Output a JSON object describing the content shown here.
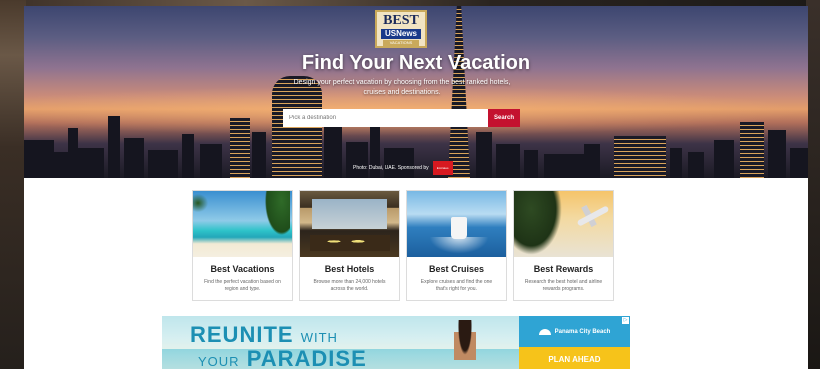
{
  "header": {
    "logo": {
      "best": "BEST",
      "brand": "USNews",
      "sub": "VACATIONS"
    },
    "title": "Find Your Next Vacation",
    "subtitle": "Design your perfect vacation by choosing from the best ranked hotels, cruises and destinations.",
    "search": {
      "placeholder": "Pick a destination",
      "button_label": "Search"
    },
    "photo_credit": "Photo: Dubai, UAE. Sponsored by",
    "sponsor": "Emirates"
  },
  "cards": [
    {
      "title": "Best Vacations",
      "description": "Find the perfect vacation based on region and type."
    },
    {
      "title": "Best Hotels",
      "description": "Browse more than 24,000 hotels across the world."
    },
    {
      "title": "Best Cruises",
      "description": "Explore cruises and find the one that's right for you."
    },
    {
      "title": "Best Rewards",
      "description": "Research the best hotel and airline rewards programs."
    }
  ],
  "ad": {
    "line1_big": "REUNITE",
    "line1_small": "WITH",
    "line2_small": "YOUR",
    "line2_big": "PARADISE",
    "brand": "Panama City Beach",
    "cta": "PLAN AHEAD",
    "info_icon": "ad-info-icon"
  },
  "colors": {
    "accent": "#c4122f",
    "ad_blue": "#1c8fb3",
    "ad_yellow": "#f6c31a"
  }
}
